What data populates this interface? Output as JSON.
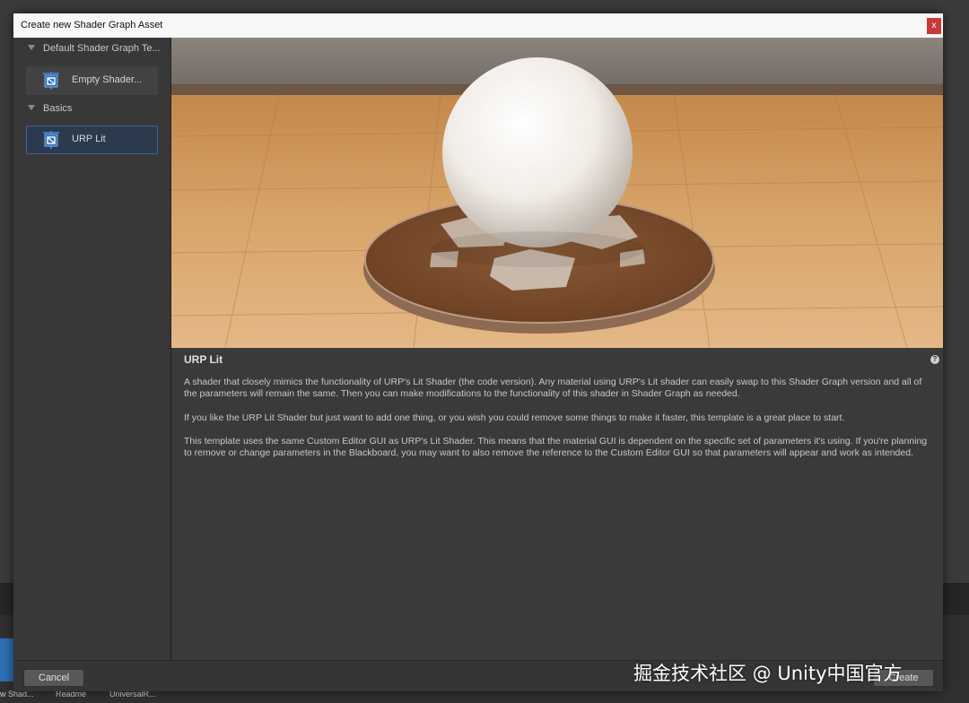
{
  "dialog": {
    "title": "Create new Shader Graph Asset",
    "close_label": "x"
  },
  "sidebar": {
    "groups": [
      {
        "label": "Default Shader Graph Te...",
        "items": [
          {
            "label": "Empty Shader..."
          }
        ]
      },
      {
        "label": "Basics",
        "items": [
          {
            "label": "URP Lit",
            "selected": true
          }
        ]
      }
    ]
  },
  "preview": {
    "icon": "shaded-sphere-preview-image"
  },
  "description": {
    "title": "URP Lit",
    "paragraphs": [
      "A shader that closely mimics the functionality of URP's Lit Shader (the code version). Any material using URP's Lit shader can easily swap to this Shader Graph version and all of the parameters will remain the same. Then you can make modifications to the functionality of this shader in Shader Graph as needed.",
      "If you like the URP Lit Shader but just want to add one thing, or you wish you could remove some things to make it faster, this template is a great place to start.",
      "This template uses the same Custom Editor GUI as URP's Lit Shader. This means that the material GUI is dependent on the specific set of parameters it's using. If you're planning to remove or change parameters in the Blackboard, you may want to also remove the reference to the Custom Editor GUI so that parameters will appear and work as intended."
    ]
  },
  "footer": {
    "cancel_label": "Cancel",
    "create_label": "Create"
  },
  "background_assets": [
    "w Shad...",
    "Readme",
    "UniversalR..."
  ],
  "watermark": "掘金技术社区 @ Unity中国官方",
  "colors": {
    "accent": "#3d6493",
    "close": "#c53a3a",
    "icon": "#2e6fb4"
  }
}
